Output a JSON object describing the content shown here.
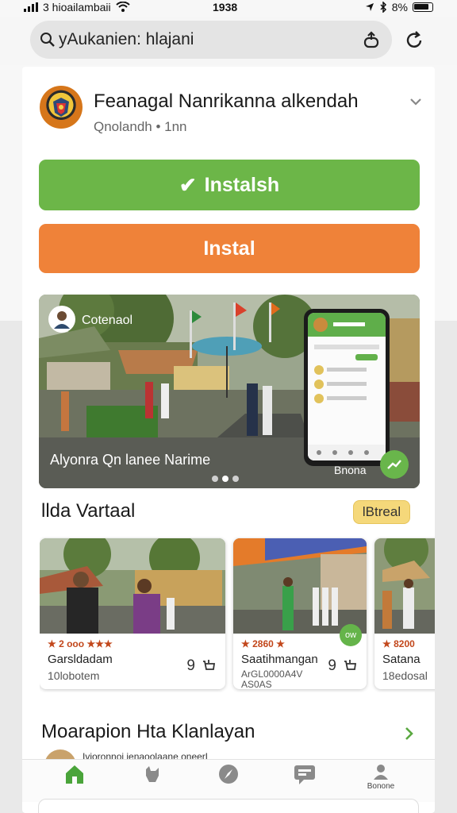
{
  "status_bar": {
    "carrier": "3 hioailambaii",
    "time": "1938",
    "battery": "8%",
    "icons": [
      "signal-icon",
      "wifi-icon",
      "location-icon",
      "bluetooth-icon",
      "battery-icon"
    ]
  },
  "search": {
    "value": "yAukanien: hlajani",
    "icon": "search-icon",
    "action_icon": "share-icon",
    "reload_icon": "reload-icon"
  },
  "app": {
    "title": "Feanagal Nanrikanna alkendah",
    "subtitle": "Qnolandh • 1nn",
    "logo_icon": "crest-logo",
    "collapse_icon": "chevron-down-icon"
  },
  "buttons": {
    "installed_label": "Instalsh",
    "install_label": "Instal",
    "green": "#6cb648",
    "orange": "#ef8239"
  },
  "hero": {
    "handle": "Cotenaol",
    "caption": "Alyonra Qn lanee Narime",
    "phone_label": "Bnona",
    "dots": 3,
    "active_dot": 1
  },
  "featured": {
    "title": "llda Vartaal",
    "see_all": "lBtreal",
    "tiles": [
      {
        "rating": "★ 2 ooo ★★★",
        "name": "Garsldadam",
        "meta": "10lobotem",
        "count": "9"
      },
      {
        "rating": "★ 2860 ★",
        "name": "Saatihmangan",
        "meta": "ArGL0000A4V\nAS0AS",
        "count": "9",
        "badge": "ow"
      },
      {
        "rating": "★ 8200",
        "name": "Satana",
        "meta": "18edosal",
        "count": ""
      }
    ]
  },
  "more": {
    "title": "Moarapion Hta Klanlayan",
    "peek_text": "Ivioronnoi ienaoolaane oneerL"
  },
  "bottom_nav": {
    "items": [
      {
        "icon": "home-icon",
        "label": "",
        "active": true
      },
      {
        "icon": "dog-icon",
        "label": ""
      },
      {
        "icon": "compass-icon",
        "label": ""
      },
      {
        "icon": "chat-icon",
        "label": ""
      },
      {
        "icon": "profile-icon",
        "label": "Bonone"
      }
    ],
    "active_color": "#4aa43a"
  }
}
